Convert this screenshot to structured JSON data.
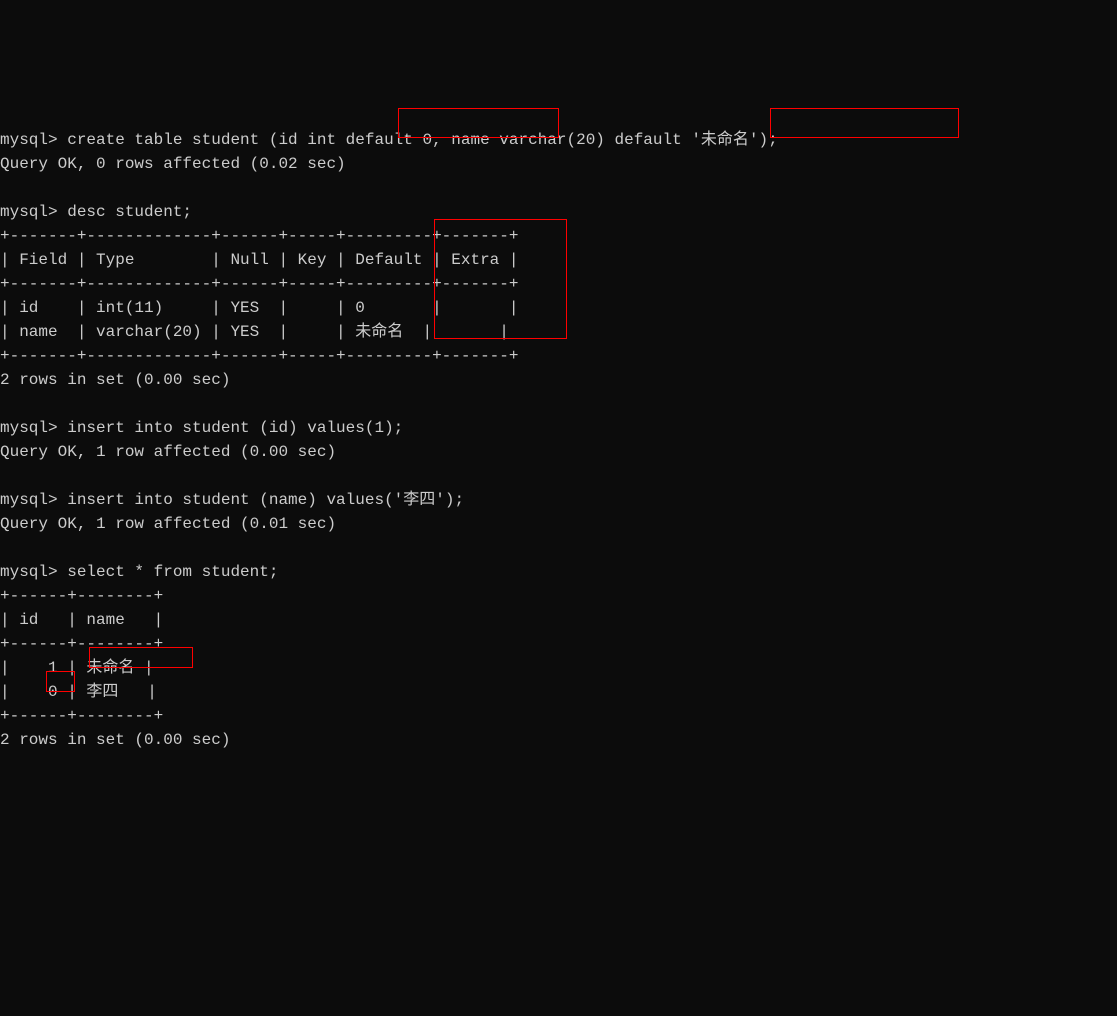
{
  "terminal": {
    "prompt": "mysql>",
    "cmd1": {
      "prefix": " create table student (id int ",
      "highlight1": "default 0,",
      "mid": " name varchar(20) ",
      "highlight2": "default '未命名'",
      "suffix": ");"
    },
    "cmd1_result": "Query OK, 0 rows affected (0.02 sec)",
    "cmd2": " desc student;",
    "desc_table": {
      "border_top": "+-------+-------------+------+-----+---------+-------+",
      "header": "| Field | Type        | Null | Key | Default | Extra |",
      "border_mid": "+-------+-------------+------+-----+---------+-------+",
      "row1": "| id    | int(11)     | YES  |     | 0       |       |",
      "row2": "| name  | varchar(20) | YES  |     | 未命名  |       |",
      "border_bot": "+-------+-------------+------+-----+---------+-------+"
    },
    "desc_result": "2 rows in set (0.00 sec)",
    "cmd3": " insert into student (id) values(1);",
    "cmd3_result": "Query OK, 1 row affected (0.00 sec)",
    "cmd4": " insert into student (name) values('李四');",
    "cmd4_result": "Query OK, 1 row affected (0.01 sec)",
    "cmd5": " select * from student;",
    "select_table": {
      "border_top": "+------+--------+",
      "header": "| id   | name   |",
      "border_mid": "+------+--------+",
      "row1": "|    1 | 未命名 |",
      "row2": "|    0 | 李四   |",
      "border_bot": "+------+--------+"
    },
    "select_result": "2 rows in set (0.00 sec)"
  }
}
